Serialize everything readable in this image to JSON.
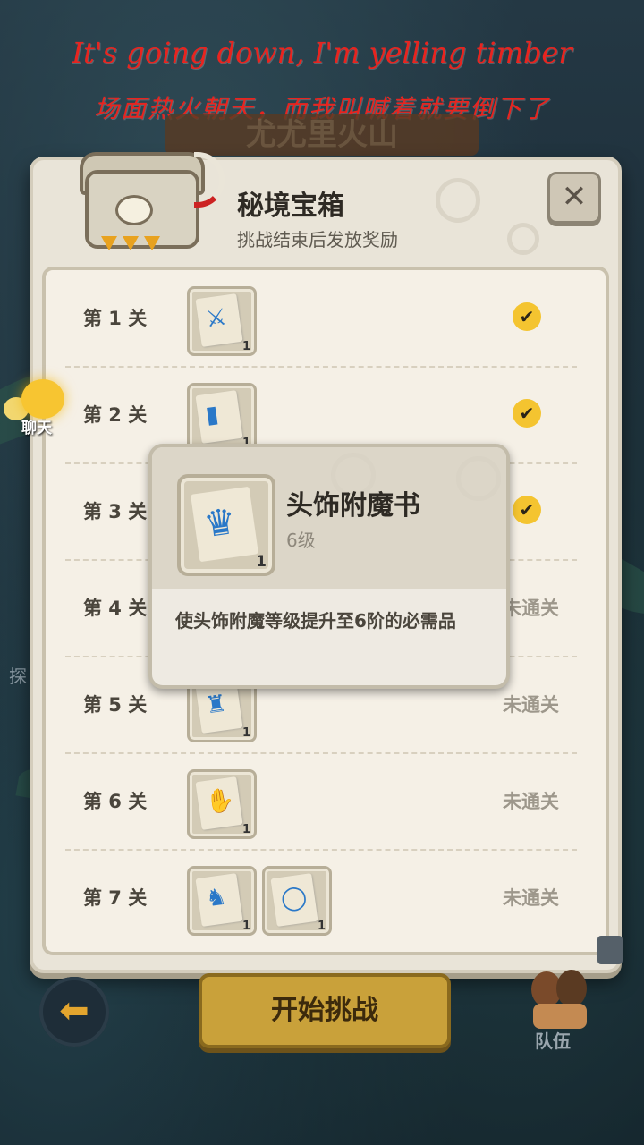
{
  "lyrics": {
    "en": "It's going down, I'm yelling timber",
    "cn": "场面热火朝天，而我叫喊着就要倒下了"
  },
  "background": {
    "banner_title": "尤尤里火山",
    "side_label": "探"
  },
  "chat": {
    "label": "聊天"
  },
  "panel": {
    "title": "秘境宝箱",
    "subtitle": "挑战结束后发放奖励",
    "close_label": "✕",
    "rows": [
      {
        "level": "第 1 关",
        "items": [
          {
            "icon": "weapon-scroll-icon",
            "glyph": "⚔",
            "count": "1"
          }
        ],
        "status": "cleared"
      },
      {
        "level": "第 2 关",
        "items": [
          {
            "icon": "armor-scroll-icon",
            "glyph": "▮",
            "count": "1"
          }
        ],
        "status": "cleared"
      },
      {
        "level": "第 3 关",
        "items": [],
        "status": "cleared"
      },
      {
        "level": "第 4 关",
        "items": [],
        "status": "未通关"
      },
      {
        "level": "第 5 关",
        "items": [
          {
            "icon": "helmet-scroll-icon",
            "glyph": "♜",
            "count": "1"
          }
        ],
        "status": "未通关"
      },
      {
        "level": "第 6 关",
        "items": [
          {
            "icon": "glove-scroll-icon",
            "glyph": "✋",
            "count": "1"
          }
        ],
        "status": "未通关"
      },
      {
        "level": "第 7 关",
        "items": [
          {
            "icon": "boot-scroll-icon",
            "glyph": "♞",
            "count": "1"
          },
          {
            "icon": "ring-scroll-icon",
            "glyph": "◯",
            "count": "1"
          }
        ],
        "status": "未通关"
      }
    ]
  },
  "tooltip": {
    "name": "头饰附魔书",
    "level": "6级",
    "count": "1",
    "description": "使头饰附魔等级提升至6阶的必需品"
  },
  "bottom": {
    "back_glyph": "⬅",
    "start_label": "开始挑战",
    "team_label": "队伍"
  },
  "colors": {
    "accent": "#f4c430",
    "lyrics": "#e8241f",
    "item_ink": "#2a78c8"
  }
}
